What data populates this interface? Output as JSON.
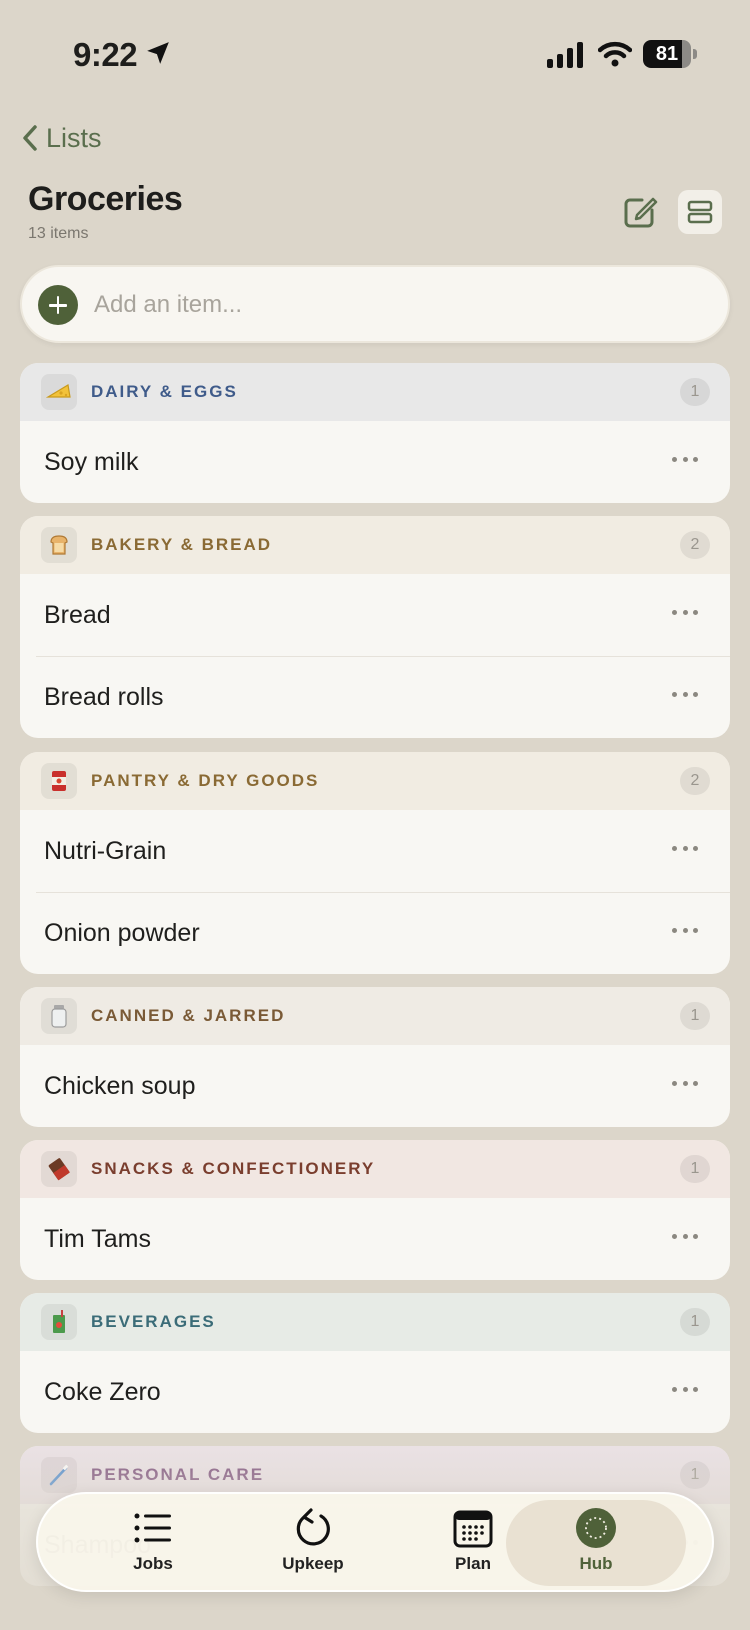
{
  "status_bar": {
    "time": "9:22",
    "battery": "81",
    "battery_level": 0.81
  },
  "nav": {
    "back_label": "Lists"
  },
  "header": {
    "title": "Groceries",
    "subtitle": "13 items"
  },
  "add_item": {
    "placeholder": "Add an item..."
  },
  "categories": [
    {
      "title": "DAIRY & EGGS",
      "count": "1",
      "icon": "cheese-icon",
      "head_color": "#e8e8e8",
      "title_color": "#3f5b8a",
      "items": [
        "Soy milk"
      ]
    },
    {
      "title": "BAKERY & BREAD",
      "count": "2",
      "icon": "bread-icon",
      "head_color": "#f1ece2",
      "title_color": "#8a6a34",
      "items": [
        "Bread",
        "Bread rolls"
      ]
    },
    {
      "title": "PANTRY & DRY GOODS",
      "count": "2",
      "icon": "can-icon",
      "head_color": "#f1ece2",
      "title_color": "#8a6a34",
      "items": [
        "Nutri-Grain",
        "Onion powder"
      ]
    },
    {
      "title": "CANNED & JARRED",
      "count": "1",
      "icon": "jar-icon",
      "head_color": "#efebe4",
      "title_color": "#7a5a36",
      "items": [
        "Chicken soup"
      ]
    },
    {
      "title": "SNACKS & CONFECTIONERY",
      "count": "1",
      "icon": "chocolate-icon",
      "head_color": "#f1e7e2",
      "title_color": "#7a3e2e",
      "items": [
        "Tim Tams"
      ]
    },
    {
      "title": "BEVERAGES",
      "count": "1",
      "icon": "juice-box-icon",
      "head_color": "#e7ebe6",
      "title_color": "#3b6c78",
      "items": [
        "Coke Zero"
      ]
    },
    {
      "title": "PERSONAL CARE",
      "count": "1",
      "icon": "toothbrush-icon",
      "head_color": "#ece3e8",
      "title_color": "#7b4e7c",
      "items": [
        "Shampoo"
      ]
    }
  ],
  "tabbar": {
    "tabs": [
      {
        "label": "Jobs",
        "icon": "list-icon"
      },
      {
        "label": "Upkeep",
        "icon": "refresh-icon"
      },
      {
        "label": "Plan",
        "icon": "calendar-icon"
      },
      {
        "label": "Hub",
        "icon": "hub-icon",
        "active": true
      }
    ]
  }
}
